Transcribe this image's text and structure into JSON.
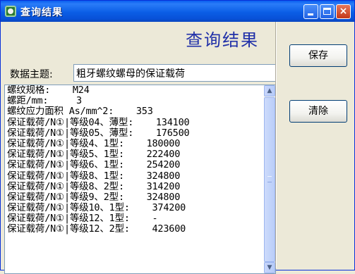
{
  "window": {
    "title": "查询结果",
    "buttons": {
      "minimize": "minimize",
      "maximize": "maximize",
      "close": "×"
    }
  },
  "header": {
    "title": "查询结果"
  },
  "topic": {
    "label": "数据主题:",
    "value": "粗牙螺纹螺母的保证载荷"
  },
  "results": {
    "lines": [
      "螺纹规格:    M24",
      "螺距/mm:     3",
      "螺纹应力面积 As/mm^2:    353",
      "保证载荷/N①|等级04、薄型:    134100",
      "保证载荷/N①|等级05、薄型:    176500",
      "保证载荷/N①|等级4、1型:    180000",
      "保证载荷/N①|等级5、1型:    222400",
      "保证载荷/N①|等级6、1型:    254200",
      "保证载荷/N①|等级8、1型:    324800",
      "保证载荷/N①|等级8、2型:    314200",
      "保证载荷/N①|等级9、2型:    324800",
      "保证载荷/N①|等级10、1型:    374200",
      "保证载荷/N①|等级12、1型:    -",
      "保证载荷/N①|等级12、2型:    423600"
    ]
  },
  "actions": {
    "save_label": "保存",
    "clear_label": "清除"
  },
  "scrollbar": {
    "up": "▲",
    "down": "▼"
  },
  "colors": {
    "title_bar": "#0a5ef0",
    "header_text": "#2030a8",
    "window_bg": "#ece9d8"
  }
}
